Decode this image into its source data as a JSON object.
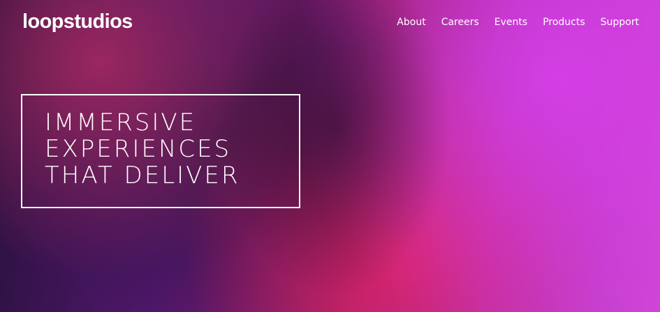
{
  "brand": {
    "logo_text": "loopstudios"
  },
  "nav": {
    "items": [
      {
        "label": "About"
      },
      {
        "label": "Careers"
      },
      {
        "label": "Events"
      },
      {
        "label": "Products"
      },
      {
        "label": "Support"
      }
    ]
  },
  "hero": {
    "headline_lines": [
      "IMMERSIVE",
      "EXPERIENCES",
      "THAT DELIVER"
    ]
  }
}
